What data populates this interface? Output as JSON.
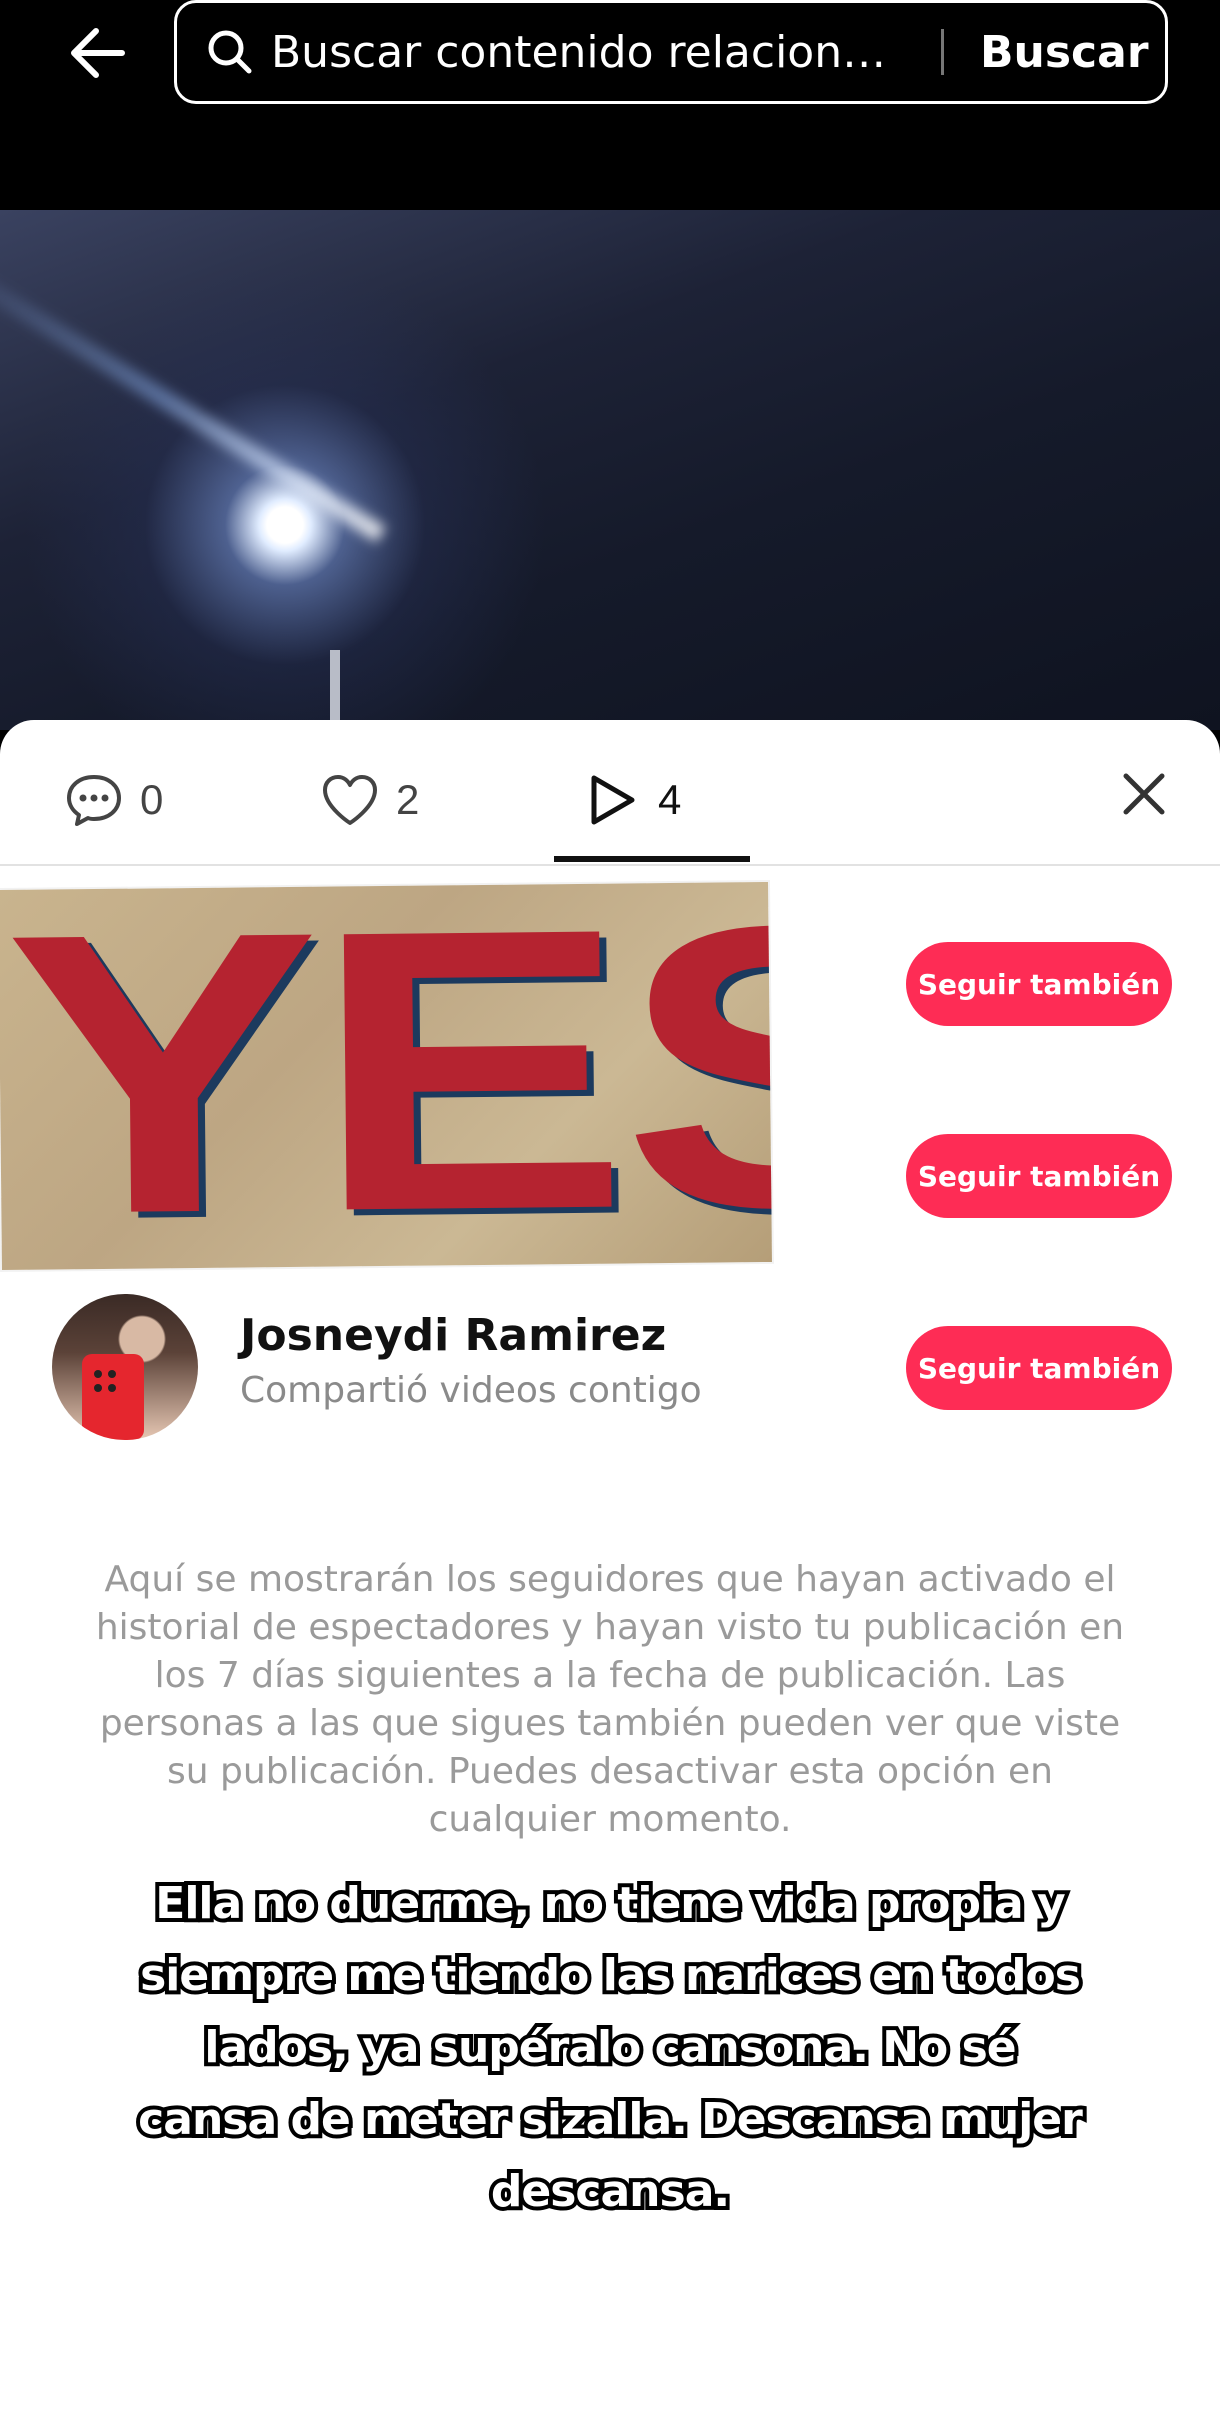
{
  "search": {
    "query": "Buscar contenido relaciona...",
    "button_label": "Buscar"
  },
  "tabs": {
    "comments_count": "0",
    "likes_count": "2",
    "views_count": "4",
    "active": "views"
  },
  "sticker_text": "YES !",
  "follow_buttons": [
    {
      "label": "Seguir también"
    },
    {
      "label": "Seguir también"
    },
    {
      "label": "Seguir también"
    }
  ],
  "user": {
    "name": "Josneydi Ramirez",
    "subtitle": "Compartió videos contigo"
  },
  "info_text": "Aquí se mostrarán los seguidores que hayan activado el historial de espectadores y hayan visto tu publicación en los 7 días siguientes a la fecha de publicación. Las personas a las que sigues también pueden ver que viste su publicación. Puedes desactivar esta opción en cualquier momento.",
  "caption": "Ella no duerme, no tiene vida propia y siempre me tiendo las narices en todos lados, ya supéralo cansona. No sé cansa de meter sizalla. Descansa mujer descansa.",
  "colors": {
    "accent": "#fe2c55",
    "background": "#000000",
    "sheet": "#ffffff"
  },
  "icons": [
    "back-arrow-icon",
    "search-icon",
    "comment-icon",
    "heart-icon",
    "play-icon",
    "close-icon"
  ]
}
